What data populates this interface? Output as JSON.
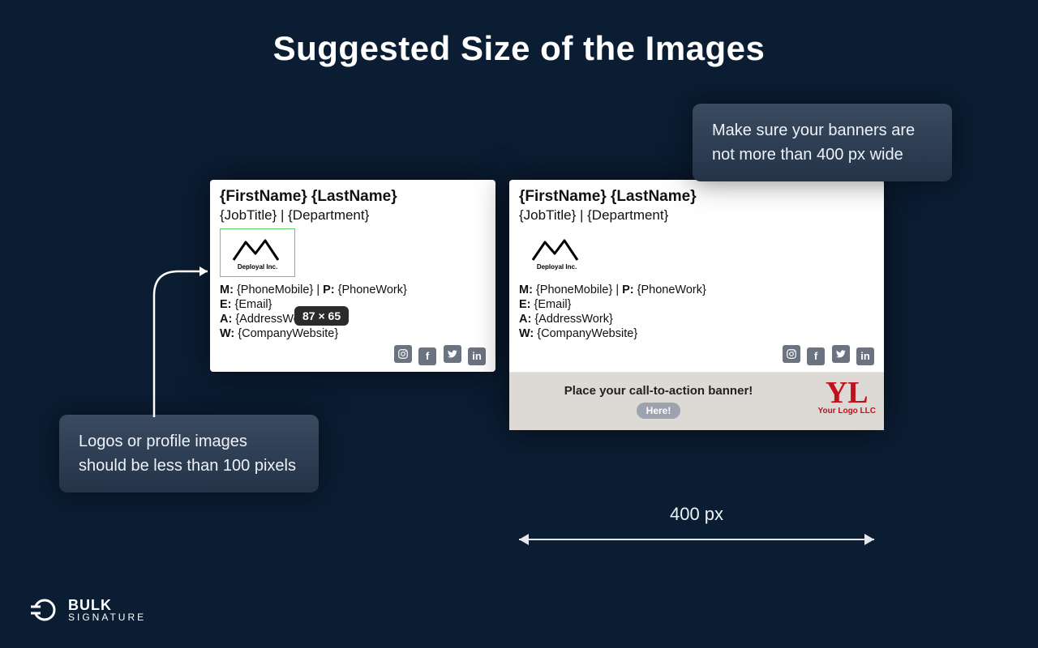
{
  "title": "Suggested Size of the Images",
  "callouts": {
    "logos": "Logos or profile images should be less than 100 pixels",
    "banners": "Make sure your banners are not more than 400 px wide"
  },
  "tooltip": {
    "dimensions": "87 × 65"
  },
  "signature": {
    "name_line": "{FirstName} {LastName}",
    "sub_line": "{JobTitle} | {Department}",
    "logo_caption": "Deployal Inc.",
    "lines": {
      "mobile_prefix": "M:",
      "mobile": "{PhoneMobile}",
      "phone_sep": " | ",
      "phone_prefix": "P:",
      "phone": "{PhoneWork}",
      "email_prefix": "E:",
      "email": "{Email}",
      "address_prefix": "A:",
      "address": "{AddressWork}",
      "web_prefix": "W:",
      "web": "{CompanyWebsite}"
    }
  },
  "banner": {
    "headline": "Place your call-to-action banner!",
    "button": "Here!",
    "logo_big": "YL",
    "logo_small": "Your Logo LLC"
  },
  "width_label": "400 px",
  "brand": {
    "line1": "BULK",
    "line2": "SIGNATURE"
  }
}
